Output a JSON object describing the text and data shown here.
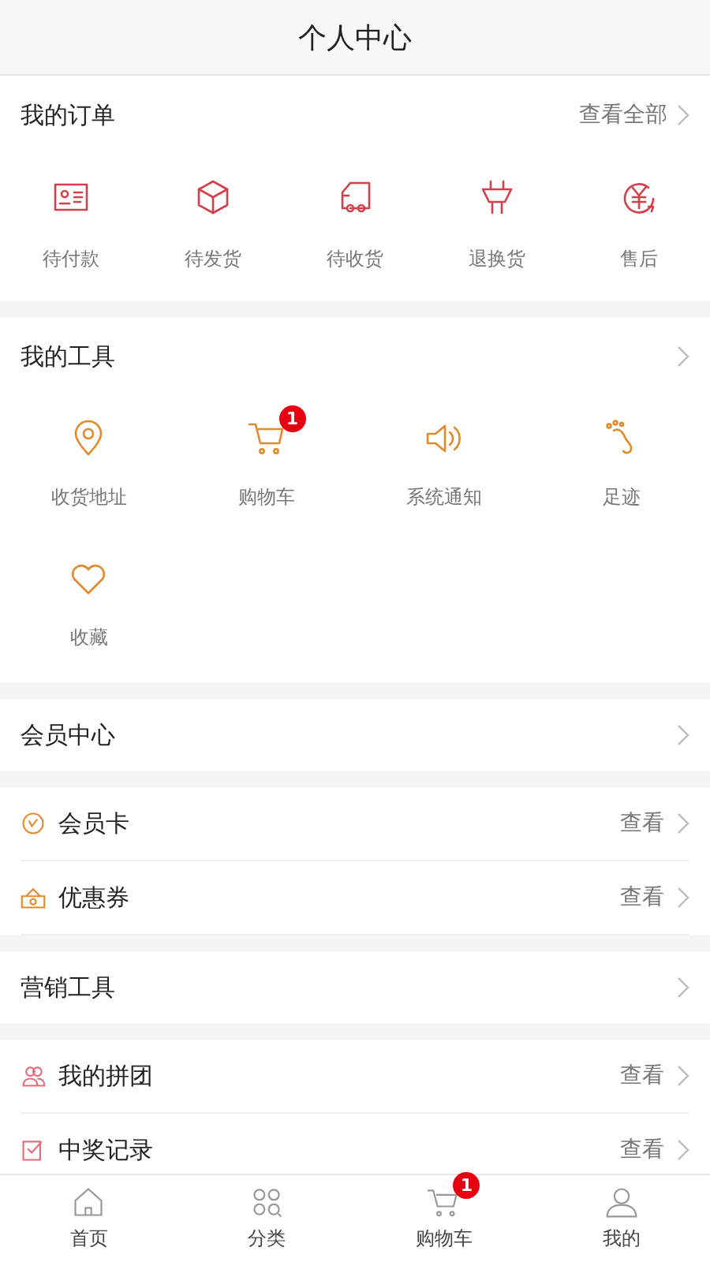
{
  "header": {
    "title": "个人中心"
  },
  "orders": {
    "title": "我的订单",
    "link": "查看全部",
    "items": [
      {
        "label": "待付款"
      },
      {
        "label": "待发货"
      },
      {
        "label": "待收货"
      },
      {
        "label": "退换货"
      },
      {
        "label": "售后"
      }
    ]
  },
  "tools": {
    "title": "我的工具",
    "items": [
      {
        "label": "收货地址"
      },
      {
        "label": "购物车",
        "badge": "1"
      },
      {
        "label": "系统通知"
      },
      {
        "label": "足迹"
      },
      {
        "label": "收藏"
      }
    ]
  },
  "sections": [
    {
      "title": "会员中心",
      "rows": [
        {
          "label": "会员卡",
          "link": "查看"
        },
        {
          "label": "优惠券",
          "link": "查看"
        }
      ]
    },
    {
      "title": "营销工具",
      "rows": [
        {
          "label": "我的拼团",
          "link": "查看"
        },
        {
          "label": "中奖记录",
          "link": "查看"
        }
      ]
    }
  ],
  "tabbar": [
    {
      "label": "首页"
    },
    {
      "label": "分类"
    },
    {
      "label": "购物车",
      "badge": "1"
    },
    {
      "label": "我的"
    }
  ]
}
